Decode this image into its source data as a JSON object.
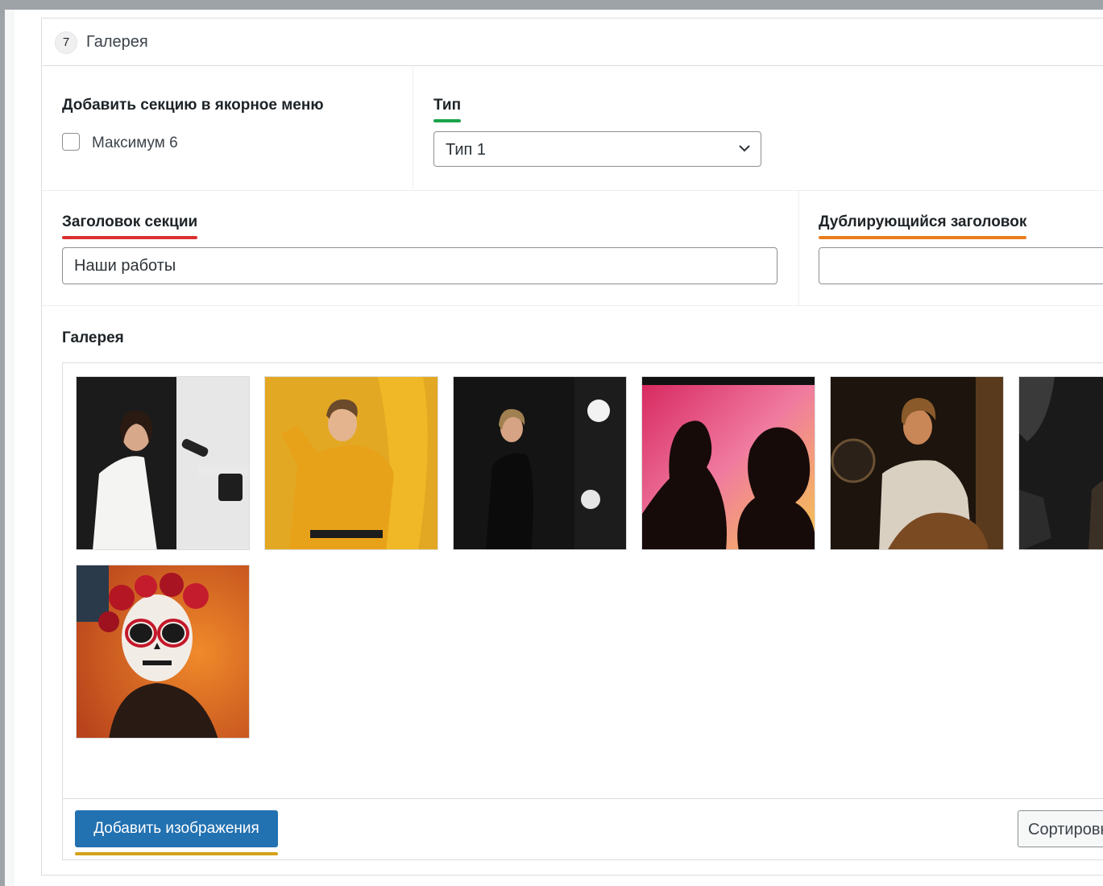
{
  "panel": {
    "order": "7",
    "title": "Галерея"
  },
  "anchor": {
    "label": "Добавить секцию в якорное меню",
    "checkbox_label": "Максимум 6",
    "checked": false
  },
  "type": {
    "label": "Тип",
    "value": "Тип 1",
    "underline_color": "#1aa34a"
  },
  "section_title": {
    "label": "Заголовок секции",
    "value": "Наши работы",
    "underline_color": "#dc2f2f"
  },
  "dup_title": {
    "label": "Дублирующийся заголовок",
    "value": "",
    "underline_color": "#e97c1c"
  },
  "gallery": {
    "label": "Галерея",
    "images": [
      {
        "name": "gallery-image-1",
        "theme": "woman-white-coat-phone"
      },
      {
        "name": "gallery-image-2",
        "theme": "man-yellow-trench-curtain"
      },
      {
        "name": "gallery-image-3",
        "theme": "woman-black-lights"
      },
      {
        "name": "gallery-image-4",
        "theme": "silhouettes-gradient"
      },
      {
        "name": "gallery-image-5",
        "theme": "boy-projector-warm"
      },
      {
        "name": "gallery-image-6",
        "theme": "dark-studio-partial"
      },
      {
        "name": "gallery-image-7",
        "theme": "catrina-makeup-flowers"
      }
    ],
    "add_button": "Добавить изображения",
    "add_underline_color": "#d4a21a",
    "sort_button": "Сортировка"
  }
}
